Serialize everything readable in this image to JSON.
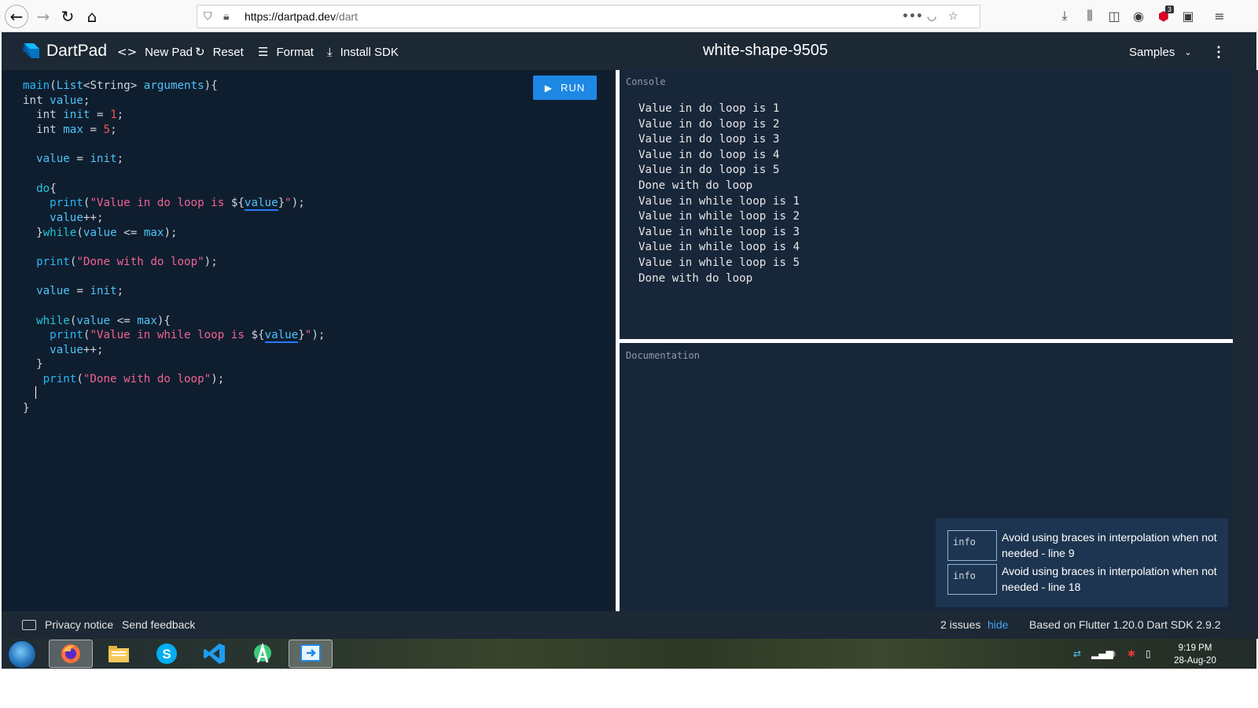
{
  "browser": {
    "url_host": "https://dartpad.dev",
    "url_path": "/dart",
    "extension_badge": "3"
  },
  "header": {
    "app_title": "DartPad",
    "new_pad": "New Pad",
    "reset": "Reset",
    "format": "Format",
    "install_sdk": "Install SDK",
    "pad_name": "white-shape-9505",
    "samples": "Samples"
  },
  "editor": {
    "run_label": "RUN",
    "lines": [
      "main(List<String> arguments){",
      "int value;",
      "  int init = 1;",
      "  int max = 5;",
      "",
      "  value = init;",
      "",
      "  do{",
      "    print(\"Value in do loop is ${value}\");",
      "    value++;",
      "  }while(value <= max);",
      "",
      "  print(\"Done with do loop\");",
      "",
      "  value = init;",
      "",
      "  while(value <= max){",
      "    print(\"Value in while loop is ${value}\");",
      "    value++;",
      "  }",
      "   print(\"Done with do loop\");",
      "",
      "}"
    ]
  },
  "console": {
    "label": "Console",
    "lines": [
      "Value in do loop is 1",
      "Value in do loop is 2",
      "Value in do loop is 3",
      "Value in do loop is 4",
      "Value in do loop is 5",
      "Done with do loop",
      "Value in while loop is 1",
      "Value in while loop is 2",
      "Value in while loop is 3",
      "Value in while loop is 4",
      "Value in while loop is 5",
      "Done with do loop"
    ]
  },
  "documentation": {
    "label": "Documentation"
  },
  "issues": [
    {
      "level": "info",
      "message": "Avoid using braces in interpolation when not needed - line 9"
    },
    {
      "level": "info",
      "message": "Avoid using braces in interpolation when not needed - line 18"
    }
  ],
  "footer": {
    "privacy": "Privacy notice",
    "feedback": "Send feedback",
    "issue_count": "2 issues",
    "hide": "hide",
    "sdk_info": "Based on Flutter 1.20.0 Dart SDK 2.9.2"
  },
  "taskbar": {
    "time": "9:19 PM",
    "date": "28-Aug-20"
  },
  "colors": {
    "header_bg": "#1c2834",
    "editor_bg": "#0f1e2f",
    "panel_bg": "#18263a",
    "run_button": "#1e88e5",
    "issues_bg": "#1d3550",
    "link": "#42a5f5"
  }
}
